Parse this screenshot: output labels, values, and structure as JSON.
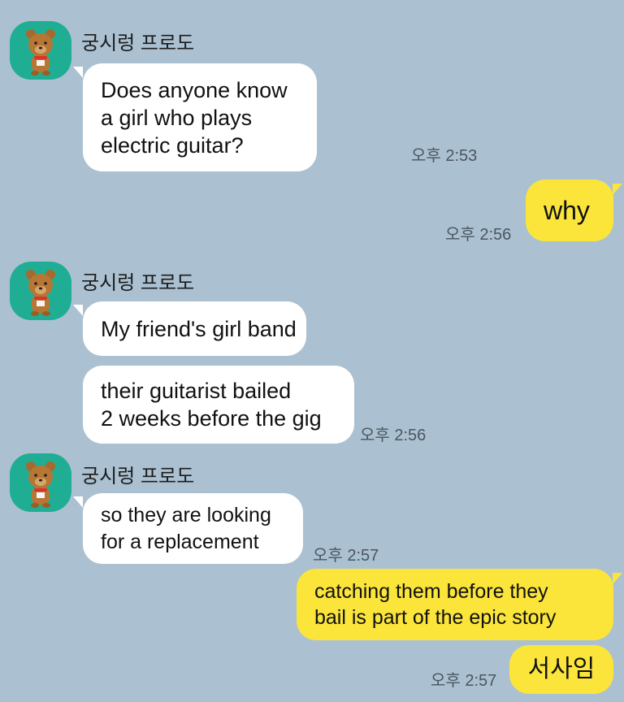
{
  "sender": {
    "name": "궁시렁 프로도",
    "avatar_icon": "bear-character-avatar-icon"
  },
  "messages": [
    {
      "dir": "in",
      "lines": [
        "Does anyone know",
        "a girl who plays",
        "electric guitar?"
      ],
      "time": "오후 2:53"
    },
    {
      "dir": "out",
      "lines": [
        "why"
      ],
      "time": "오후 2:56"
    },
    {
      "dir": "in",
      "lines": [
        "My friend's girl band"
      ]
    },
    {
      "dir": "in",
      "lines": [
        "their guitarist bailed",
        "2 weeks before the gig"
      ],
      "time": "오후 2:56"
    },
    {
      "dir": "in",
      "lines": [
        "so they are looking",
        "for a replacement"
      ],
      "time": "오후 2:57"
    },
    {
      "dir": "out",
      "lines": [
        "catching them before they",
        "bail is part of the epic story"
      ]
    },
    {
      "dir": "out",
      "lines": [
        "서사임"
      ],
      "time": "오후 2:57"
    }
  ],
  "colors": {
    "background": "#abc1d1",
    "incoming_bubble": "#ffffff",
    "outgoing_bubble": "#fbe53b",
    "avatar_bg": "#1fae94"
  }
}
